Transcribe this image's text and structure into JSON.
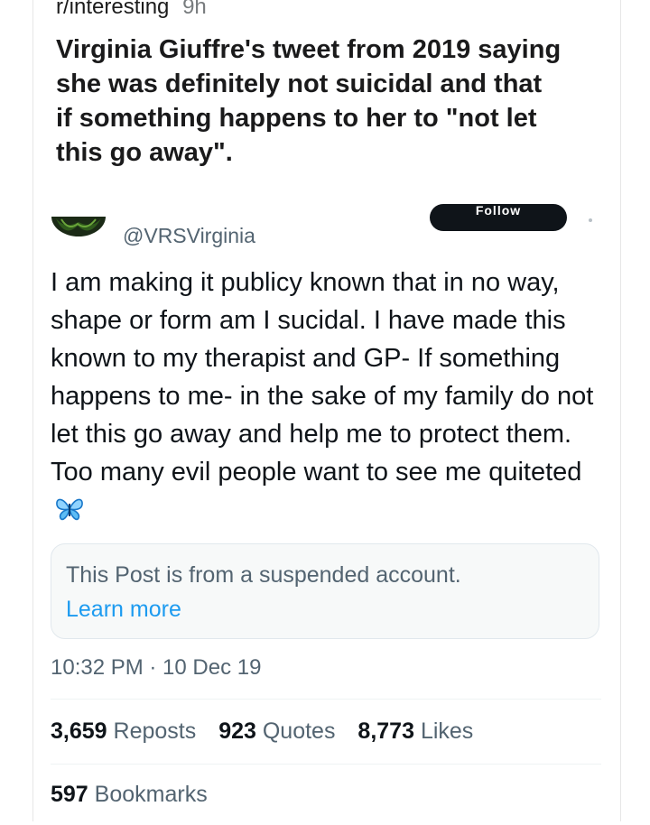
{
  "reddit_post": {
    "subreddit": "r/interesting",
    "age": "9h",
    "title": "Virginia Giuffre's tweet from 2019 saying she was definitely not suicidal and that if something happens to her to \"not let this go away\"."
  },
  "tweet": {
    "handle": "@VRSVirginia",
    "follow_label": "Follow",
    "text": "I am making it publicy known that in no way, shape or form am I sucidal. I have made this known to my therapist and GP- If something happens to me- in the sake of my family do not let this go away and help me to protect them. Too many evil people want to see me quiteted",
    "emoji_icon": "butterfly-emoji",
    "suspended_notice": "This Post is from a suspended account.",
    "learn_more": "Learn more",
    "timestamp": "10:32 PM · 10 Dec 19",
    "stats": {
      "reposts_count": "3,659",
      "reposts_label": "Reposts",
      "quotes_count": "923",
      "quotes_label": "Quotes",
      "likes_count": "8,773",
      "likes_label": "Likes",
      "bookmarks_count": "597",
      "bookmarks_label": "Bookmarks"
    }
  },
  "colors": {
    "text_primary": "#0f1419",
    "text_secondary": "#536471",
    "link": "#1d9bf0",
    "follow_button_bg": "#0f1419",
    "butterfly": "#1d9bf0"
  }
}
